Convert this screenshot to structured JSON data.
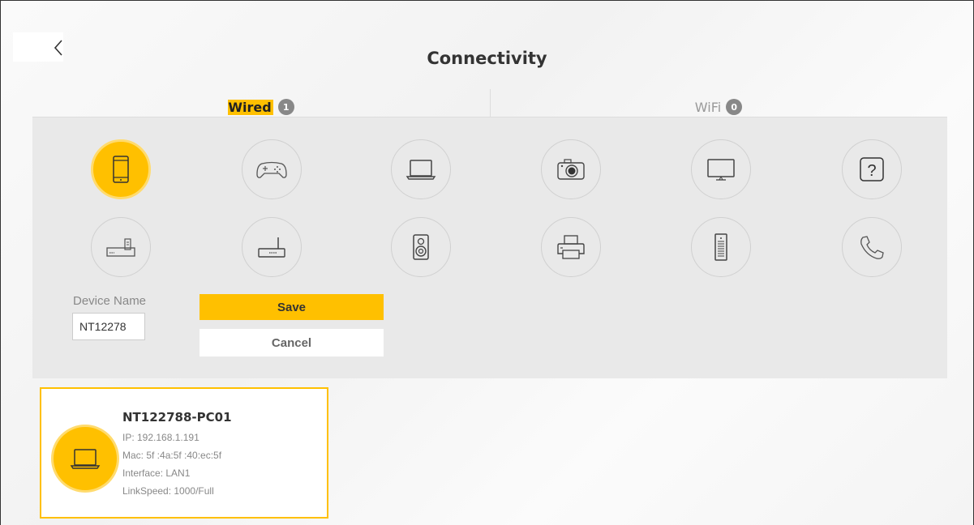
{
  "page": {
    "title": "Connectivity",
    "back_icon": "chevron-left-icon"
  },
  "tabs": [
    {
      "label_highlight": "W",
      "label_rest": "ired",
      "count": "1",
      "active": true
    },
    {
      "label": "WiFi",
      "count": "0",
      "active": false
    }
  ],
  "device_types": [
    {
      "icon": "smartphone-icon",
      "selected": true
    },
    {
      "icon": "gamepad-icon",
      "selected": false
    },
    {
      "icon": "laptop-icon",
      "selected": false
    },
    {
      "icon": "camera-icon",
      "selected": false
    },
    {
      "icon": "monitor-icon",
      "selected": false
    },
    {
      "icon": "unknown-device-icon",
      "selected": false
    },
    {
      "icon": "set-top-box-icon",
      "selected": false
    },
    {
      "icon": "router-icon",
      "selected": false
    },
    {
      "icon": "speaker-icon",
      "selected": false
    },
    {
      "icon": "printer-icon",
      "selected": false
    },
    {
      "icon": "server-icon",
      "selected": false
    },
    {
      "icon": "phone-icon",
      "selected": false
    }
  ],
  "form": {
    "device_name_label": "Device Name",
    "device_name_value": "NT12278",
    "save_label": "Save",
    "cancel_label": "Cancel"
  },
  "device_card": {
    "icon": "laptop-icon",
    "name": "NT122788-PC01",
    "ip": "IP: 192.168.1.191",
    "mac": "Mac: 5f :4a:5f :40:ec:5f",
    "interface": "Interface: LAN1",
    "link_speed": "LinkSpeed: 1000/Full"
  },
  "colors": {
    "accent": "#ffc000",
    "accent_ring": "#ffdb6e",
    "panel": "#e9e9e9",
    "text_muted": "#888888"
  }
}
